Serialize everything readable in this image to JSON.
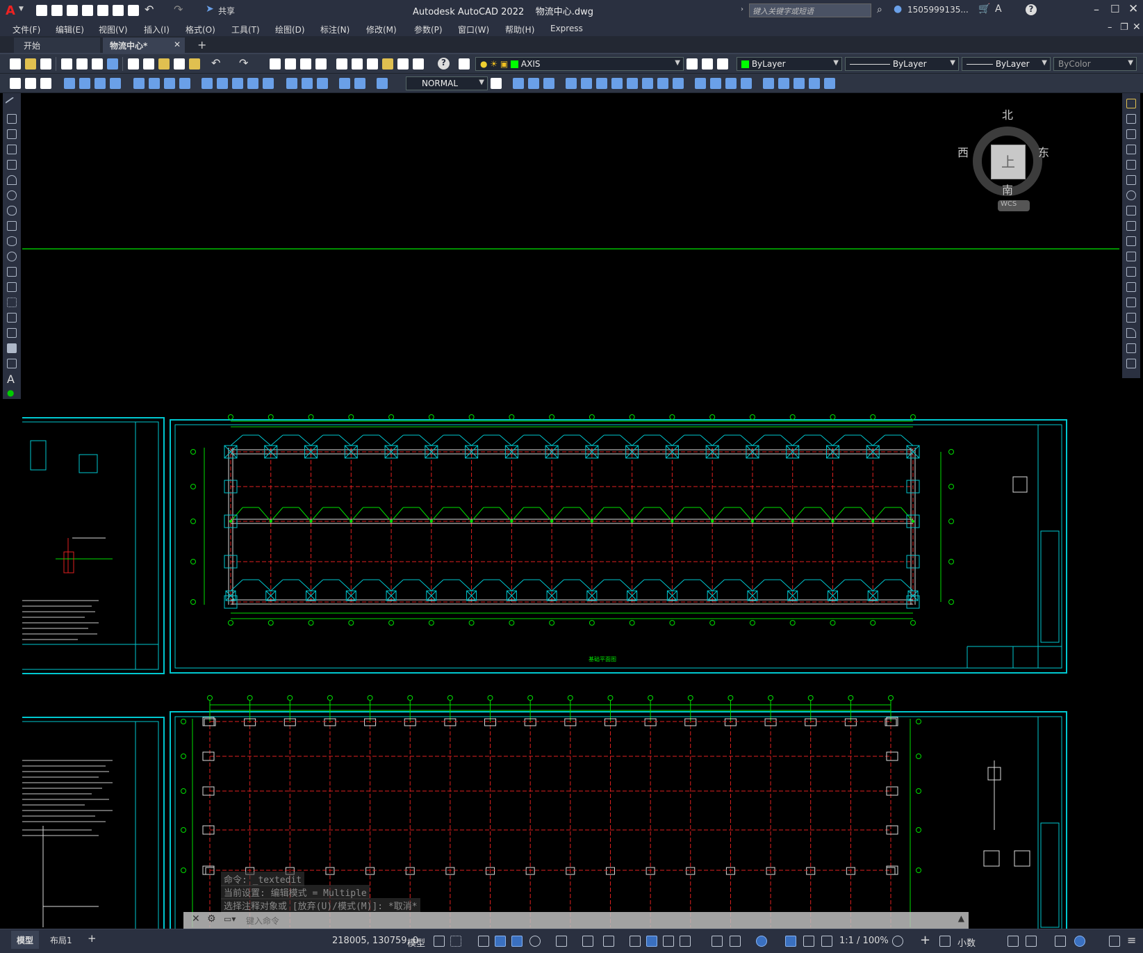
{
  "app": {
    "title": "Autodesk AutoCAD 2022",
    "filename": "物流中心.dwg",
    "share_label": "共享",
    "search_placeholder": "键入关键字或短语",
    "user": "1505999135...",
    "help": "?"
  },
  "menu": [
    "文件(F)",
    "编辑(E)",
    "视图(V)",
    "插入(I)",
    "格式(O)",
    "工具(T)",
    "绘图(D)",
    "标注(N)",
    "修改(M)",
    "参数(P)",
    "窗口(W)",
    "帮助(H)",
    "Express"
  ],
  "tabs": [
    {
      "label": "开始",
      "active": false
    },
    {
      "label": "物流中心*",
      "active": true
    }
  ],
  "tab_add": "+",
  "toolbar": {
    "layer": "AXIS",
    "color": "ByLayer",
    "linetype": "ByLayer",
    "lineweight": "ByLayer",
    "plotstyle": "ByColor",
    "visual_style": "NORMAL"
  },
  "viewcube": {
    "north": "北",
    "south": "南",
    "east": "东",
    "west": "西",
    "top": "上",
    "wcs": "WCS"
  },
  "command": {
    "history": [
      "命令: _textedit",
      "当前设置: 编辑模式 = Multiple",
      "选择注释对象或 [放弃(U)/模式(M)]: *取消*"
    ],
    "placeholder": "键入命令"
  },
  "layout_tabs": [
    {
      "label": "模型",
      "active": true
    },
    {
      "label": "布局1",
      "active": false
    }
  ],
  "layout_add": "+",
  "status": {
    "coords": "218005, 130759, 0",
    "model": "模型",
    "scale": "1:1 / 100%",
    "units": "小数"
  },
  "colors": {
    "sheet_border": "#00c8d0",
    "grid_red": "#e02020",
    "structure_green": "#00e000",
    "accent": "#3a70c0"
  },
  "drawing_titles": [
    "基础平面图"
  ]
}
